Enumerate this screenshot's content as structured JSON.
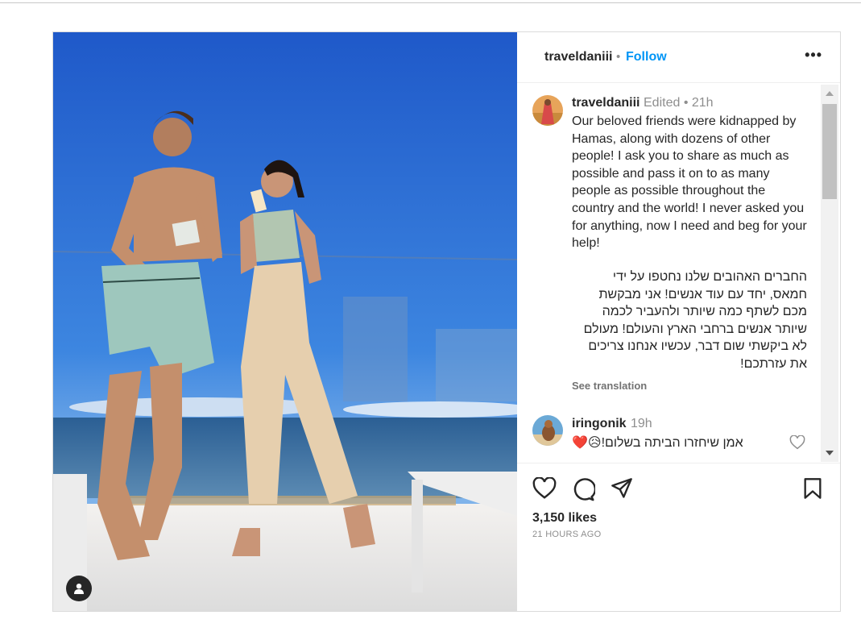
{
  "post": {
    "username": "traveldaniii",
    "separator": "•",
    "follow_label": "Follow",
    "more_label": "•••",
    "caption": {
      "username": "traveldaniii",
      "meta": "Edited •  21h",
      "english": "Our beloved friends were kidnapped by Hamas, along with dozens of other people! I ask you to share as much as possible and pass it on to as many people as possible throughout the country and the world! I never asked you for anything, now I need and beg for your help!",
      "hebrew": "החברים האהובים שלנו נחטפו על ידי חמאס, יחד עם עוד אנשים! אני מבקשת מכם לשתף כמה שיותר ולהעביר לכמה שיותר אנשים ברחבי הארץ והעולם! מעולם לא ביקשתי שום דבר, עכשיו אנחנו צריכים את עזרתכם!",
      "see_translation": "See translation"
    },
    "comment": {
      "username": "iringonik",
      "time": "19h",
      "text": "אמן שיחזרו הביתה בשלום!😥❤️"
    },
    "likes": "3,150 likes",
    "time_ago": "21 HOURS AGO",
    "icons": [
      "heart-icon",
      "comment-icon",
      "share-icon",
      "bookmark-icon",
      "person-tag-icon",
      "more-icon"
    ],
    "colors": {
      "link": "#0095f6",
      "muted": "#8e8e8e",
      "text": "#262626",
      "sky": "#2d6fd4"
    }
  }
}
